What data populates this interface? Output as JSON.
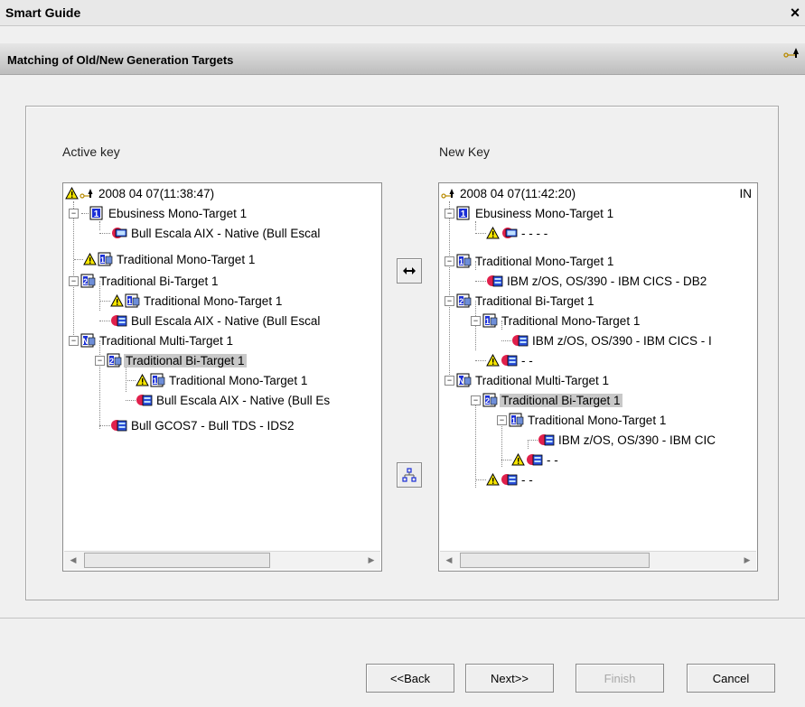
{
  "window": {
    "title": "Smart Guide",
    "close_label": "×"
  },
  "header": {
    "title": "Matching of Old/New Generation Targets"
  },
  "left_panel": {
    "label": "Active key",
    "rows": [
      {
        "text": "2008 04 07(11:38:47)"
      },
      {
        "text": "Ebusiness Mono-Target 1"
      },
      {
        "text": "Bull Escala AIX - Native (Bull Escal"
      },
      {
        "text": "Traditional Mono-Target 1"
      },
      {
        "text": "Traditional Bi-Target 1"
      },
      {
        "text": "Traditional Mono-Target 1"
      },
      {
        "text": "Bull Escala AIX - Native (Bull Escal"
      },
      {
        "text": "Traditional Multi-Target 1"
      },
      {
        "text": "Traditional Bi-Target 1"
      },
      {
        "text": "Traditional Mono-Target 1"
      },
      {
        "text": "Bull Escala AIX - Native (Bull Es"
      },
      {
        "text": "Bull GCOS7 - Bull TDS - IDS2"
      }
    ]
  },
  "right_panel": {
    "label": "New Key",
    "rows": [
      {
        "text": "2008 04 07(11:42:20)",
        "extra": "IN"
      },
      {
        "text": "Ebusiness Mono-Target 1"
      },
      {
        "text": "- - - -"
      },
      {
        "text": "Traditional Mono-Target 1"
      },
      {
        "text": "IBM z/OS, OS/390 - IBM CICS - DB2"
      },
      {
        "text": "Traditional Bi-Target 1"
      },
      {
        "text": "Traditional Mono-Target 1"
      },
      {
        "text": "IBM z/OS, OS/390 - IBM CICS - I"
      },
      {
        "text": "- -"
      },
      {
        "text": "Traditional Multi-Target 1"
      },
      {
        "text": "Traditional Bi-Target 1"
      },
      {
        "text": "Traditional Mono-Target 1"
      },
      {
        "text": "IBM z/OS, OS/390 - IBM CIC"
      },
      {
        "text": "- -"
      },
      {
        "text": "- -"
      }
    ]
  },
  "middle_buttons": {
    "map_icon": "double-arrow-icon",
    "tree_icon": "tree-link-icon"
  },
  "buttons": {
    "back": "<<Back",
    "next": "Next>>",
    "finish": "Finish",
    "cancel": "Cancel"
  },
  "colors": {
    "selection": "#c8c8c8",
    "header_gradient_top": "#e6e6e6",
    "header_gradient_bottom": "#bdbdbd"
  }
}
